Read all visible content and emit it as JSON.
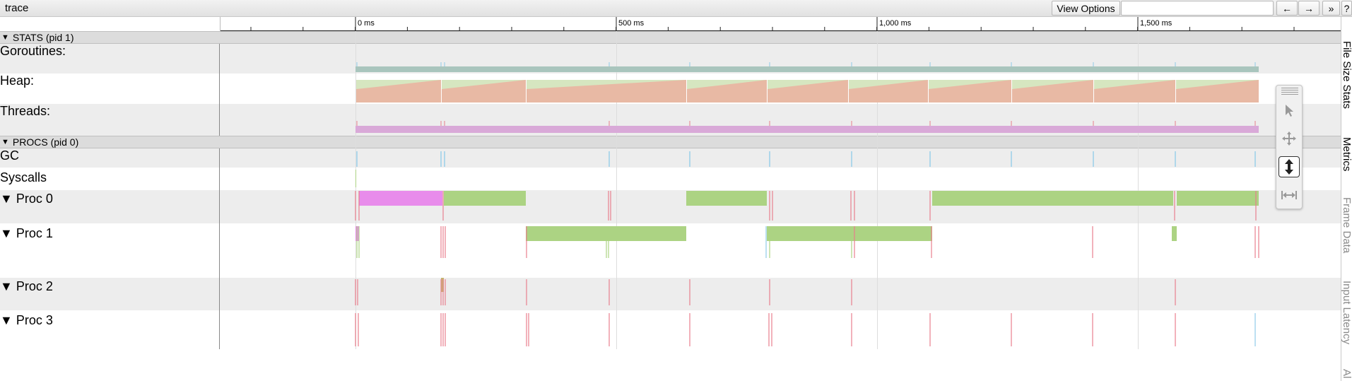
{
  "app": {
    "title": "trace"
  },
  "toolbar": {
    "view_options_label": "View Options",
    "search_value": "",
    "prev_label": "←",
    "next_label": "→",
    "expand_label": "»",
    "help_label": "?"
  },
  "ruler": {
    "tick_labels": [
      "0 ms",
      "500 ms",
      "1,000 ms",
      "1,500 ms"
    ]
  },
  "sections": {
    "stats": {
      "label": "STATS (pid 1)",
      "tri": "▼"
    },
    "procs": {
      "label": "PROCS (pid 0)",
      "tri": "▼"
    }
  },
  "tracks": {
    "goroutines": "Goroutines:",
    "heap": "Heap:",
    "threads": "Threads:",
    "gc": "GC",
    "syscalls": "Syscalls",
    "proc0": "▼  Proc 0",
    "proc1": "▼  Proc 1",
    "proc2": "▼  Proc 2",
    "proc3": "▼  Proc 3"
  },
  "side_tabs": [
    "File Size Stats",
    "Metrics",
    "Frame Data",
    "Input Latency",
    "Al"
  ],
  "mouse_modes": {
    "modes": [
      "selection",
      "pan",
      "zoom",
      "timing"
    ],
    "active": "zoom"
  },
  "colors": {
    "goroutines_bar": "#a9c5bd",
    "heap_allocated": "#e8b9a4",
    "heap_next_gc": "#d6e6c0",
    "threads_bar": "#d9a9d8",
    "gc_marks": "#8ecbe8",
    "proc_running": "#acd383",
    "proc_gc": "#e88ceb",
    "proc_ticks": "#e87f8d"
  }
}
